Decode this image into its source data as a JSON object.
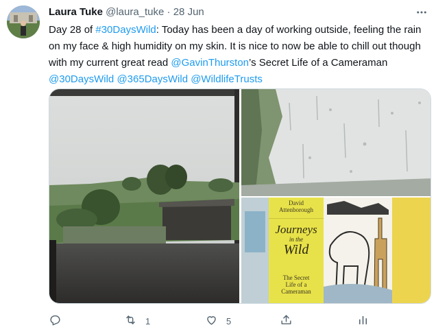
{
  "tweet": {
    "display_name": "Laura Tuke",
    "handle": "@laura_tuke",
    "separator": "·",
    "date": "28 Jun",
    "text": {
      "part1": "Day 28 of ",
      "hashtag1": "#30DaysWild",
      "part2": ": Today has been a day of working outside, feeling the rain on my face & high humidity on my skin. It is nice to now be able to chill out though with my current great read ",
      "mention1": "@GavinThurston",
      "part3": "’s Secret Life of a Cameraman ",
      "mention2": "@30DaysWild",
      "mention3": "@365DaysWild",
      "mention4": "@WildlifeTrusts"
    },
    "book": {
      "author_line1": "David",
      "author_line2": "Attenborough",
      "title_line1": "Journeys",
      "title_line2": "in the",
      "title_line3": "Wild",
      "subtitle_line1": "The Secret",
      "subtitle_line2": "Life of a",
      "subtitle_line3": "Cameraman"
    },
    "stats": {
      "replies": "",
      "retweets": "1",
      "likes": "5"
    }
  },
  "colors": {
    "link": "#1d9bf0",
    "muted": "#536471",
    "text": "#0f1419"
  },
  "icons": [
    "reply-icon",
    "retweet-icon",
    "like-icon",
    "share-icon",
    "analytics-icon",
    "more-icon"
  ]
}
